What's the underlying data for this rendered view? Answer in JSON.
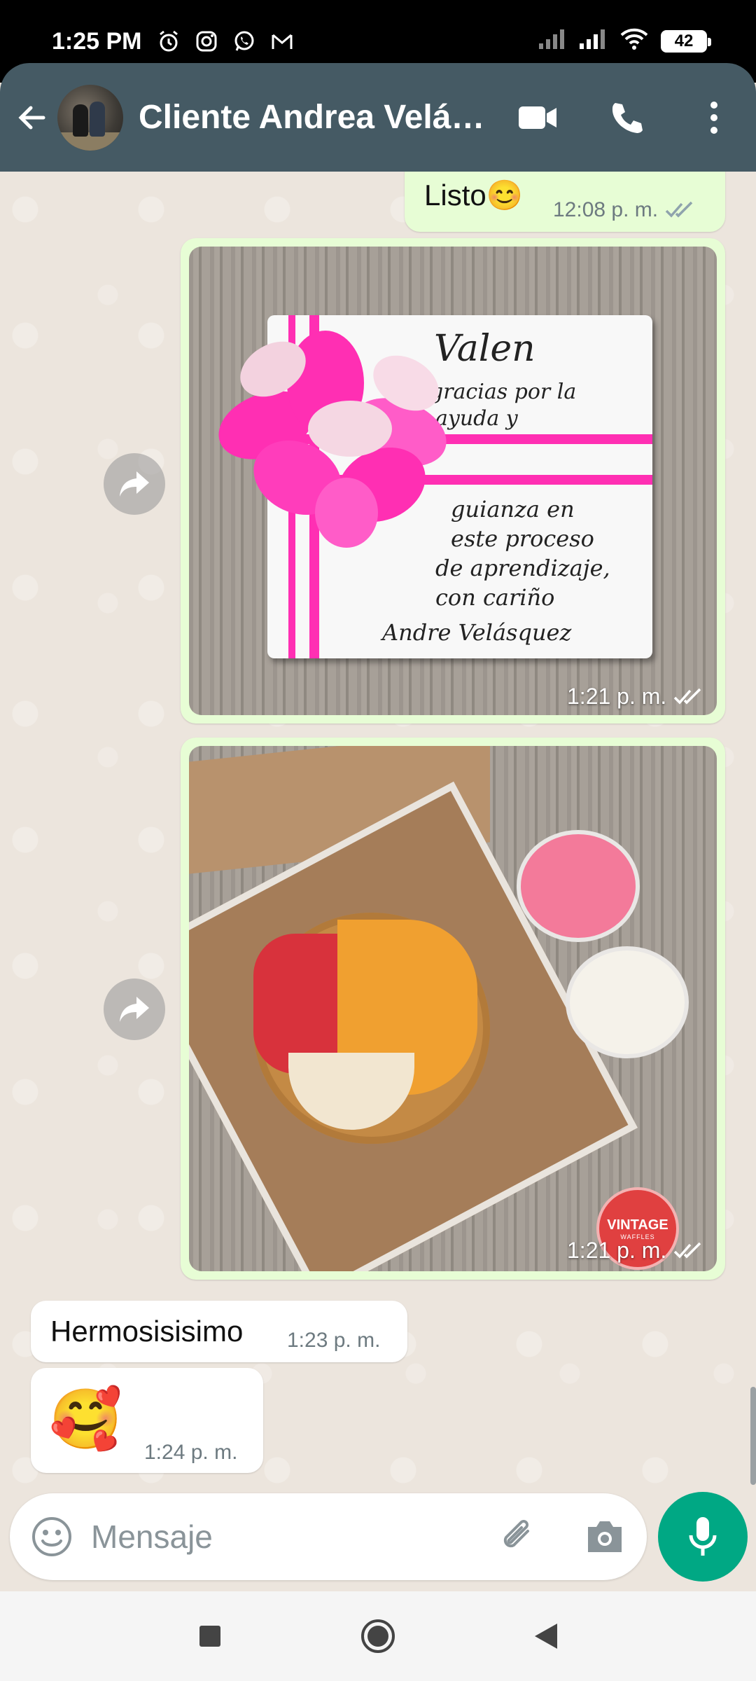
{
  "status_bar": {
    "time": "1:25 PM",
    "battery": "42",
    "icons": [
      "alarm-icon",
      "instagram-icon",
      "whatsapp-icon",
      "gmail-icon",
      "signal-icon",
      "signal-icon",
      "wifi-icon",
      "battery-icon"
    ]
  },
  "header": {
    "contact_name": "Cliente Andrea Velázquez",
    "icons": [
      "back-arrow-icon",
      "video-call-icon",
      "phone-call-icon",
      "more-vert-icon"
    ],
    "accent": "#455a64"
  },
  "messages": [
    {
      "type": "outgoing_text",
      "text": "Listo",
      "emoji": "😊",
      "time": "12:08 p. m.",
      "status": "read"
    },
    {
      "type": "outgoing_image",
      "time": "1:21 p. m.",
      "status": "read",
      "handwriting": [
        "Valen",
        "gracias por la",
        "ayuda y",
        "guianza en",
        "este proceso",
        "de aprendizaje,",
        "con cariño",
        "Andre Velásquez"
      ]
    },
    {
      "type": "outgoing_image",
      "time": "1:21 p. m.",
      "status": "read",
      "logo": {
        "title": "VINTAGE",
        "subtitle": "WAFFLES"
      }
    },
    {
      "type": "incoming_text",
      "text": "Hermosisisimo",
      "time": "1:23 p. m."
    },
    {
      "type": "incoming_emoji",
      "emoji": "🥰",
      "time": "1:24 p. m."
    }
  ],
  "input": {
    "placeholder": "Mensaje"
  },
  "colors": {
    "outgoing_bubble": "#e7fdd5",
    "incoming_bubble": "#ffffff",
    "chat_bg": "#ece5dd",
    "mic_button": "#00a884",
    "read_tick": "#53bdeb"
  }
}
